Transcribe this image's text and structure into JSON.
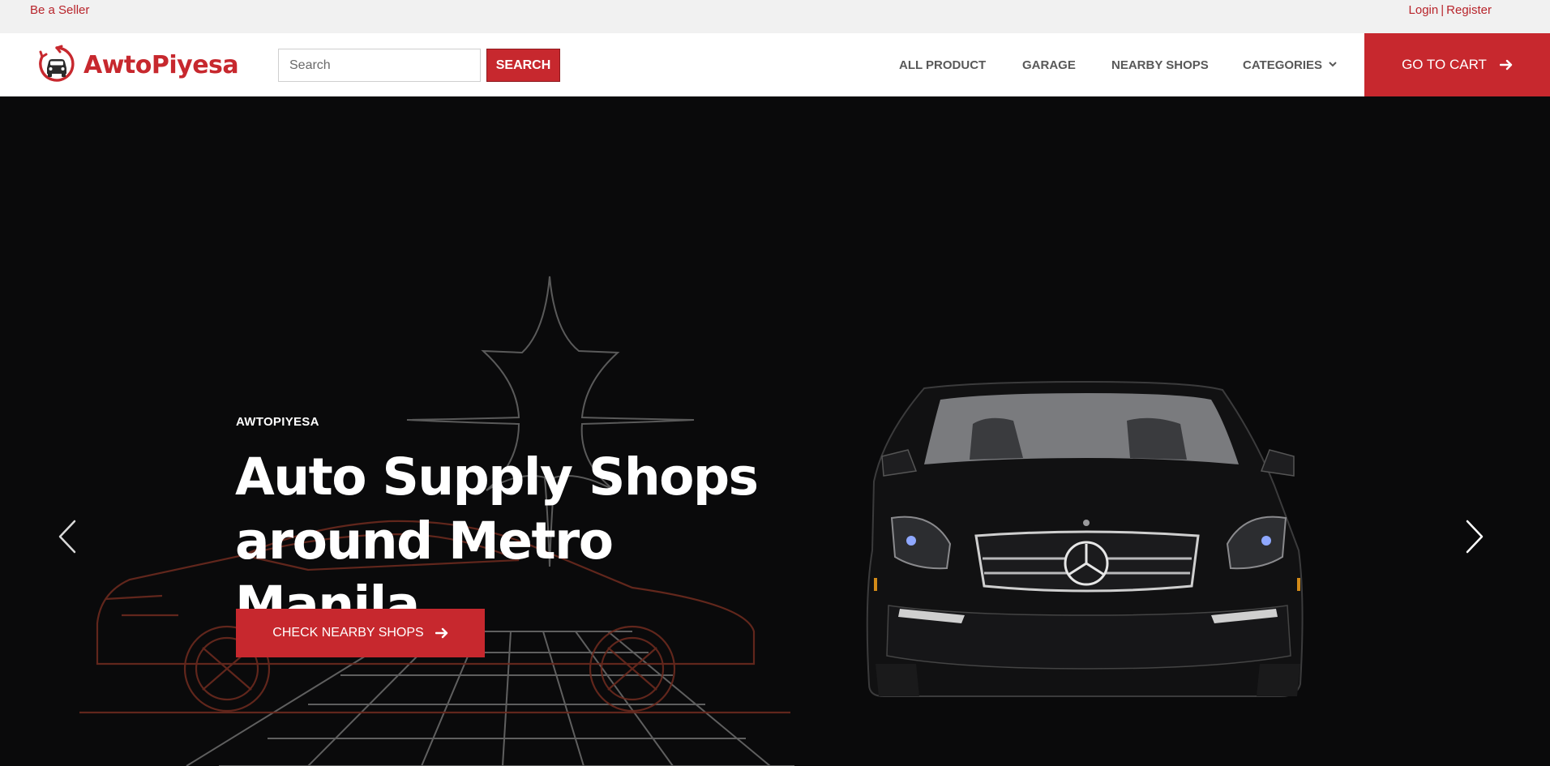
{
  "topbar": {
    "seller_link": "Be a Seller",
    "login_link": "Login",
    "separator": "|",
    "register_link": "Register"
  },
  "header": {
    "brand": "AwtoPiyesa",
    "search": {
      "placeholder": "Search",
      "value": "",
      "button_label": "SEARCH"
    },
    "nav": [
      {
        "label": "ALL PRODUCT"
      },
      {
        "label": "GARAGE"
      },
      {
        "label": "NEARBY SHOPS"
      },
      {
        "label": "CATEGORIES",
        "icon": "chevron-down-icon"
      }
    ],
    "cart_label": "GO TO CART",
    "cart_icon": "arrow-right-icon"
  },
  "hero": {
    "eyebrow": "AWTOPIYESA",
    "headline_line1": "Auto Supply Shops",
    "headline_line2": "around Metro Manila",
    "cta_label": "CHECK NEARBY SHOPS",
    "cta_icon": "arrow-right-icon",
    "prev_icon": "chevron-left-icon",
    "next_icon": "chevron-right-icon"
  },
  "colors": {
    "accent": "#c7282e",
    "topbar_bg": "#f1f1f1",
    "hero_bg": "#0a0a0b",
    "nav_text": "#595959"
  }
}
